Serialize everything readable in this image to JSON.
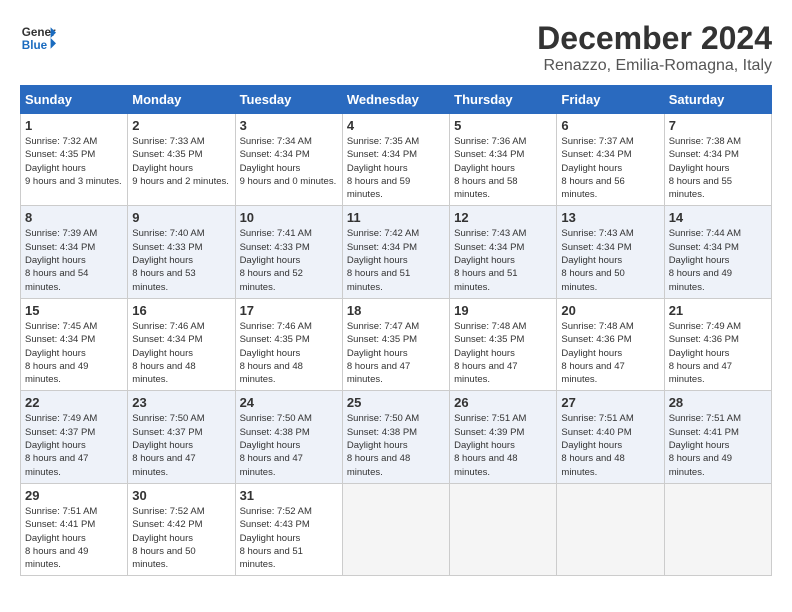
{
  "header": {
    "logo_line1": "General",
    "logo_line2": "Blue",
    "month_title": "December 2024",
    "subtitle": "Renazzo, Emilia-Romagna, Italy"
  },
  "weekdays": [
    "Sunday",
    "Monday",
    "Tuesday",
    "Wednesday",
    "Thursday",
    "Friday",
    "Saturday"
  ],
  "weeks": [
    [
      {
        "day": "1",
        "sunrise": "7:32 AM",
        "sunset": "4:35 PM",
        "daylight": "9 hours and 3 minutes."
      },
      {
        "day": "2",
        "sunrise": "7:33 AM",
        "sunset": "4:35 PM",
        "daylight": "9 hours and 2 minutes."
      },
      {
        "day": "3",
        "sunrise": "7:34 AM",
        "sunset": "4:34 PM",
        "daylight": "9 hours and 0 minutes."
      },
      {
        "day": "4",
        "sunrise": "7:35 AM",
        "sunset": "4:34 PM",
        "daylight": "8 hours and 59 minutes."
      },
      {
        "day": "5",
        "sunrise": "7:36 AM",
        "sunset": "4:34 PM",
        "daylight": "8 hours and 58 minutes."
      },
      {
        "day": "6",
        "sunrise": "7:37 AM",
        "sunset": "4:34 PM",
        "daylight": "8 hours and 56 minutes."
      },
      {
        "day": "7",
        "sunrise": "7:38 AM",
        "sunset": "4:34 PM",
        "daylight": "8 hours and 55 minutes."
      }
    ],
    [
      {
        "day": "8",
        "sunrise": "7:39 AM",
        "sunset": "4:34 PM",
        "daylight": "8 hours and 54 minutes."
      },
      {
        "day": "9",
        "sunrise": "7:40 AM",
        "sunset": "4:33 PM",
        "daylight": "8 hours and 53 minutes."
      },
      {
        "day": "10",
        "sunrise": "7:41 AM",
        "sunset": "4:33 PM",
        "daylight": "8 hours and 52 minutes."
      },
      {
        "day": "11",
        "sunrise": "7:42 AM",
        "sunset": "4:34 PM",
        "daylight": "8 hours and 51 minutes."
      },
      {
        "day": "12",
        "sunrise": "7:43 AM",
        "sunset": "4:34 PM",
        "daylight": "8 hours and 51 minutes."
      },
      {
        "day": "13",
        "sunrise": "7:43 AM",
        "sunset": "4:34 PM",
        "daylight": "8 hours and 50 minutes."
      },
      {
        "day": "14",
        "sunrise": "7:44 AM",
        "sunset": "4:34 PM",
        "daylight": "8 hours and 49 minutes."
      }
    ],
    [
      {
        "day": "15",
        "sunrise": "7:45 AM",
        "sunset": "4:34 PM",
        "daylight": "8 hours and 49 minutes."
      },
      {
        "day": "16",
        "sunrise": "7:46 AM",
        "sunset": "4:34 PM",
        "daylight": "8 hours and 48 minutes."
      },
      {
        "day": "17",
        "sunrise": "7:46 AM",
        "sunset": "4:35 PM",
        "daylight": "8 hours and 48 minutes."
      },
      {
        "day": "18",
        "sunrise": "7:47 AM",
        "sunset": "4:35 PM",
        "daylight": "8 hours and 47 minutes."
      },
      {
        "day": "19",
        "sunrise": "7:48 AM",
        "sunset": "4:35 PM",
        "daylight": "8 hours and 47 minutes."
      },
      {
        "day": "20",
        "sunrise": "7:48 AM",
        "sunset": "4:36 PM",
        "daylight": "8 hours and 47 minutes."
      },
      {
        "day": "21",
        "sunrise": "7:49 AM",
        "sunset": "4:36 PM",
        "daylight": "8 hours and 47 minutes."
      }
    ],
    [
      {
        "day": "22",
        "sunrise": "7:49 AM",
        "sunset": "4:37 PM",
        "daylight": "8 hours and 47 minutes."
      },
      {
        "day": "23",
        "sunrise": "7:50 AM",
        "sunset": "4:37 PM",
        "daylight": "8 hours and 47 minutes."
      },
      {
        "day": "24",
        "sunrise": "7:50 AM",
        "sunset": "4:38 PM",
        "daylight": "8 hours and 47 minutes."
      },
      {
        "day": "25",
        "sunrise": "7:50 AM",
        "sunset": "4:38 PM",
        "daylight": "8 hours and 48 minutes."
      },
      {
        "day": "26",
        "sunrise": "7:51 AM",
        "sunset": "4:39 PM",
        "daylight": "8 hours and 48 minutes."
      },
      {
        "day": "27",
        "sunrise": "7:51 AM",
        "sunset": "4:40 PM",
        "daylight": "8 hours and 48 minutes."
      },
      {
        "day": "28",
        "sunrise": "7:51 AM",
        "sunset": "4:41 PM",
        "daylight": "8 hours and 49 minutes."
      }
    ],
    [
      {
        "day": "29",
        "sunrise": "7:51 AM",
        "sunset": "4:41 PM",
        "daylight": "8 hours and 49 minutes."
      },
      {
        "day": "30",
        "sunrise": "7:52 AM",
        "sunset": "4:42 PM",
        "daylight": "8 hours and 50 minutes."
      },
      {
        "day": "31",
        "sunrise": "7:52 AM",
        "sunset": "4:43 PM",
        "daylight": "8 hours and 51 minutes."
      },
      null,
      null,
      null,
      null
    ]
  ]
}
